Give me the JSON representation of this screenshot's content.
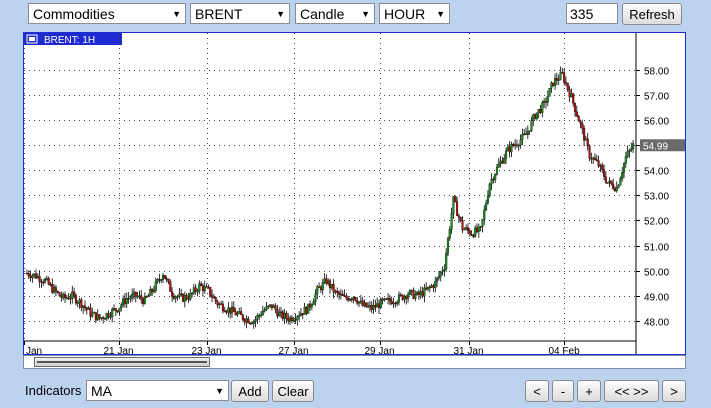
{
  "toolbar": {
    "market": "Commodities",
    "symbol": "BRENT",
    "chart_type": "Candle",
    "interval": "HOUR",
    "count": "335",
    "refresh_label": "Refresh"
  },
  "chart": {
    "legend_label": "BRENT: 1H",
    "last_price_label": "54.99"
  },
  "bottom": {
    "indicators_label": "Indicators",
    "indicator_value": "MA",
    "add_label": "Add",
    "clear_label": "Clear",
    "nav": {
      "back": "<",
      "zoom_out": "-",
      "zoom_in": "+",
      "fit": "<< >>",
      "forward": ">"
    }
  },
  "colors": {
    "background": "#bcd3ef",
    "frame_border": "#1d2bd0",
    "legend_bg": "#1d2bd0",
    "candle_up": "#1e8a1e",
    "candle_down": "#b01010",
    "price_tag_bg": "#6a6a6a"
  },
  "icons": {
    "legend_box": "window-icon",
    "dropdown": "chevron-down-icon"
  },
  "chart_data": {
    "type": "candlestick",
    "y_axis": {
      "min": 47.2,
      "max": 58.9,
      "ticks": [
        "48.00",
        "49.00",
        "50.00",
        "51.00",
        "52.00",
        "53.00",
        "54.00",
        "55.00",
        "56.00",
        "57.00",
        "58.00"
      ]
    },
    "x_axis": {
      "labels": [
        "Jan",
        "21 Jan",
        "23 Jan",
        "27 Jan",
        "29 Jan",
        "31 Jan",
        "04 Feb"
      ]
    },
    "last_price": 54.99,
    "series": [
      {
        "t": 0,
        "close": 49.9
      },
      {
        "t": 5,
        "close": 49.8
      },
      {
        "t": 10,
        "close": 49.6
      },
      {
        "t": 15,
        "close": 49.2
      },
      {
        "t": 20,
        "close": 48.9
      },
      {
        "t": 25,
        "close": 49.0
      },
      {
        "t": 30,
        "close": 48.7
      },
      {
        "t": 35,
        "close": 48.3
      },
      {
        "t": 40,
        "close": 48.1
      },
      {
        "t": 45,
        "close": 48.3
      },
      {
        "t": 50,
        "close": 48.5
      },
      {
        "t": 55,
        "close": 48.9
      },
      {
        "t": 60,
        "close": 49.0
      },
      {
        "t": 65,
        "close": 48.8
      },
      {
        "t": 70,
        "close": 49.3
      },
      {
        "t": 75,
        "close": 49.9
      },
      {
        "t": 80,
        "close": 49.1
      },
      {
        "t": 85,
        "close": 48.9
      },
      {
        "t": 90,
        "close": 49.0
      },
      {
        "t": 95,
        "close": 49.4
      },
      {
        "t": 100,
        "close": 49.2
      },
      {
        "t": 105,
        "close": 48.7
      },
      {
        "t": 110,
        "close": 48.5
      },
      {
        "t": 115,
        "close": 48.3
      },
      {
        "t": 120,
        "close": 48.1
      },
      {
        "t": 125,
        "close": 48.0
      },
      {
        "t": 130,
        "close": 48.4
      },
      {
        "t": 135,
        "close": 48.6
      },
      {
        "t": 140,
        "close": 48.2
      },
      {
        "t": 145,
        "close": 48.1
      },
      {
        "t": 150,
        "close": 48.3
      },
      {
        "t": 155,
        "close": 48.5
      },
      {
        "t": 160,
        "close": 49.2
      },
      {
        "t": 165,
        "close": 49.6
      },
      {
        "t": 170,
        "close": 49.1
      },
      {
        "t": 175,
        "close": 48.9
      },
      {
        "t": 180,
        "close": 49.0
      },
      {
        "t": 185,
        "close": 48.6
      },
      {
        "t": 190,
        "close": 48.5
      },
      {
        "t": 195,
        "close": 48.7
      },
      {
        "t": 200,
        "close": 48.8
      },
      {
        "t": 205,
        "close": 48.9
      },
      {
        "t": 210,
        "close": 49.1
      },
      {
        "t": 215,
        "close": 49.0
      },
      {
        "t": 220,
        "close": 49.2
      },
      {
        "t": 225,
        "close": 49.5
      },
      {
        "t": 230,
        "close": 50.2
      },
      {
        "t": 235,
        "close": 52.8
      },
      {
        "t": 240,
        "close": 51.7
      },
      {
        "t": 245,
        "close": 51.5
      },
      {
        "t": 250,
        "close": 51.6
      },
      {
        "t": 255,
        "close": 53.5
      },
      {
        "t": 260,
        "close": 54.2
      },
      {
        "t": 265,
        "close": 54.8
      },
      {
        "t": 270,
        "close": 55.1
      },
      {
        "t": 275,
        "close": 55.4
      },
      {
        "t": 280,
        "close": 56.2
      },
      {
        "t": 285,
        "close": 56.6
      },
      {
        "t": 290,
        "close": 57.5
      },
      {
        "t": 295,
        "close": 57.8
      },
      {
        "t": 300,
        "close": 56.9
      },
      {
        "t": 305,
        "close": 55.8
      },
      {
        "t": 310,
        "close": 54.6
      },
      {
        "t": 315,
        "close": 54.2
      },
      {
        "t": 320,
        "close": 53.5
      },
      {
        "t": 325,
        "close": 53.3
      },
      {
        "t": 330,
        "close": 54.5
      },
      {
        "t": 334,
        "close": 54.99
      }
    ]
  }
}
